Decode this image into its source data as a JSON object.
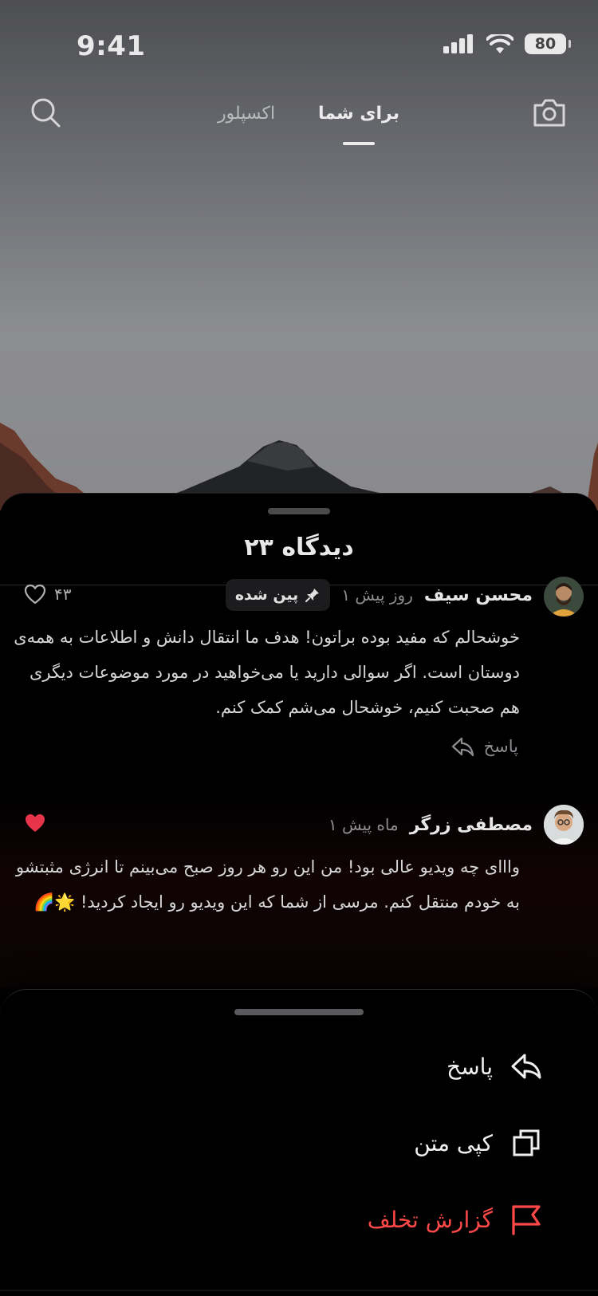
{
  "status_bar": {
    "time": "9:41",
    "battery": "80"
  },
  "topnav": {
    "tabs": [
      {
        "label": "برای شما",
        "active": true
      },
      {
        "label": "اکسپلور",
        "active": false
      }
    ],
    "icons": {
      "left": "search-icon",
      "right": "camera-icon"
    }
  },
  "comments_sheet": {
    "title": "۲۳ دیدگاه",
    "comments": [
      {
        "author": "محسن سیف",
        "time": "۱ روز پیش",
        "pinned_label": "پین شده",
        "text": "خوشحالم که مفید بوده براتون! هدف ما انتقال دانش و اطلاعات به همه‌ی دوستان است. اگر سوالی دارید یا می‌خواهید در مورد موضوعات دیگری هم صحبت کنیم، خوشحال می‌شم کمک کنم.",
        "likes": "۴۳",
        "liked": false,
        "reply_label": "پاسخ"
      },
      {
        "author": "مصطفی زرگر",
        "time": "۱ ماه پیش",
        "text": "وااای چه ویدیو عالی بود! من این رو هر روز صبح می‌بینم تا انرژی مثبتشو به خودم منتقل کنم. مرسی از شما که این ویدیو رو ایجاد کردید! 🌟🌈",
        "liked": true
      }
    ]
  },
  "action_sheet": {
    "actions": [
      {
        "label": "پاسخ",
        "icon": "reply-icon"
      },
      {
        "label": "کپی متن",
        "icon": "copy-icon"
      },
      {
        "label": "گزارش تخلف",
        "icon": "flag-icon",
        "color": "#ff4848"
      }
    ]
  },
  "colors": {
    "danger": "#ff4848",
    "like_active": "#e8344a",
    "sheet_bg": "#000000"
  }
}
